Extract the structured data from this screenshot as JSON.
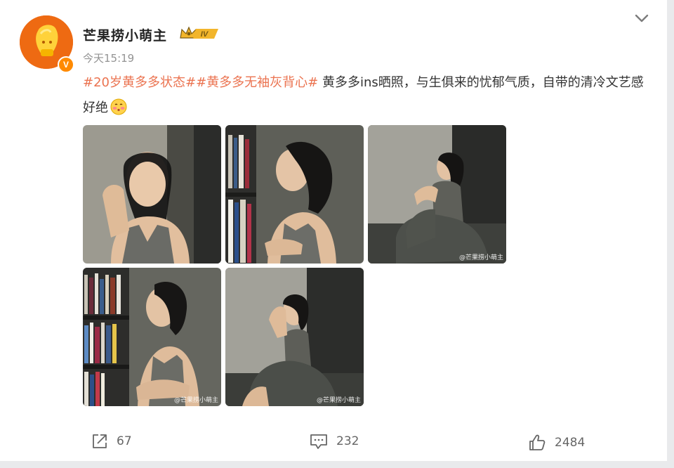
{
  "user": {
    "name": "芒果捞小萌主",
    "level_badge": "IV",
    "verified_mark": "V",
    "avatar_icon": "mango-mascot-avatar"
  },
  "post": {
    "time": "今天15:19",
    "topic1": "#20岁黄多多状态#",
    "topic2": "#黄多多无袖灰背心#",
    "text": " 黄多多ins晒照，与生俱来的忧郁气质，自带的清冷文艺感好绝",
    "emoji": "blush-face-emoji"
  },
  "photos": [
    {
      "label": "photo-1"
    },
    {
      "label": "photo-2"
    },
    {
      "label": "photo-3",
      "watermark": "@芒果捞小萌主"
    },
    {
      "label": "photo-4",
      "watermark": "@芒果捞小萌主"
    },
    {
      "label": "photo-5",
      "watermark": "@芒果捞小萌主"
    }
  ],
  "actions": {
    "repost_count": "67",
    "comment_count": "232",
    "like_count": "2484"
  },
  "colors": {
    "topic": "#eb7350",
    "avatar_bg": "#ee6a12",
    "vip_gold": "#f2b52b"
  }
}
